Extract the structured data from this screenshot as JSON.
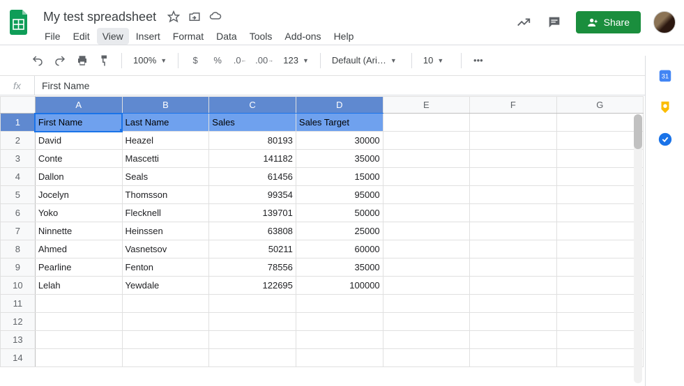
{
  "doc": {
    "title": "My test spreadsheet"
  },
  "menu": {
    "file": "File",
    "edit": "Edit",
    "view": "View",
    "insert": "Insert",
    "format": "Format",
    "data": "Data",
    "tools": "Tools",
    "addons": "Add-ons",
    "help": "Help"
  },
  "share": {
    "label": "Share"
  },
  "toolbar": {
    "zoom": "100%",
    "font": "Default (Ari…",
    "size": "10",
    "more": "•••"
  },
  "formula": {
    "value": "First Name"
  },
  "columns": [
    "A",
    "B",
    "C",
    "D",
    "E",
    "F",
    "G"
  ],
  "selectedCols": [
    "A",
    "B",
    "C",
    "D"
  ],
  "rows": [
    {
      "n": "1",
      "sel": true,
      "hdr": true,
      "c": [
        "First Name",
        "Last Name",
        "Sales",
        "Sales Target",
        "",
        "",
        ""
      ]
    },
    {
      "n": "2",
      "c": [
        "David",
        "Heazel",
        "80193",
        "30000",
        "",
        "",
        ""
      ]
    },
    {
      "n": "3",
      "c": [
        "Conte",
        "Mascetti",
        "141182",
        "35000",
        "",
        "",
        ""
      ]
    },
    {
      "n": "4",
      "c": [
        "Dallon",
        "Seals",
        "61456",
        "15000",
        "",
        "",
        ""
      ]
    },
    {
      "n": "5",
      "c": [
        "Jocelyn",
        "Thomsson",
        "99354",
        "95000",
        "",
        "",
        ""
      ]
    },
    {
      "n": "6",
      "c": [
        "Yoko",
        "Flecknell",
        "139701",
        "50000",
        "",
        "",
        ""
      ]
    },
    {
      "n": "7",
      "c": [
        "Ninnette",
        "Heinssen",
        "63808",
        "25000",
        "",
        "",
        ""
      ]
    },
    {
      "n": "8",
      "c": [
        "Ahmed",
        "Vasnetsov",
        "50211",
        "60000",
        "",
        "",
        ""
      ]
    },
    {
      "n": "9",
      "c": [
        "Pearline",
        "Fenton",
        "78556",
        "35000",
        "",
        "",
        ""
      ]
    },
    {
      "n": "10",
      "c": [
        "Lelah",
        "Yewdale",
        "122695",
        "100000",
        "",
        "",
        ""
      ]
    },
    {
      "n": "11",
      "c": [
        "",
        "",
        "",
        "",
        "",
        "",
        ""
      ]
    },
    {
      "n": "12",
      "c": [
        "",
        "",
        "",
        "",
        "",
        "",
        ""
      ]
    },
    {
      "n": "13",
      "c": [
        "",
        "",
        "",
        "",
        "",
        "",
        ""
      ]
    },
    {
      "n": "14",
      "c": [
        "",
        "",
        "",
        "",
        "",
        "",
        ""
      ]
    }
  ],
  "numericCols": [
    2,
    3
  ]
}
